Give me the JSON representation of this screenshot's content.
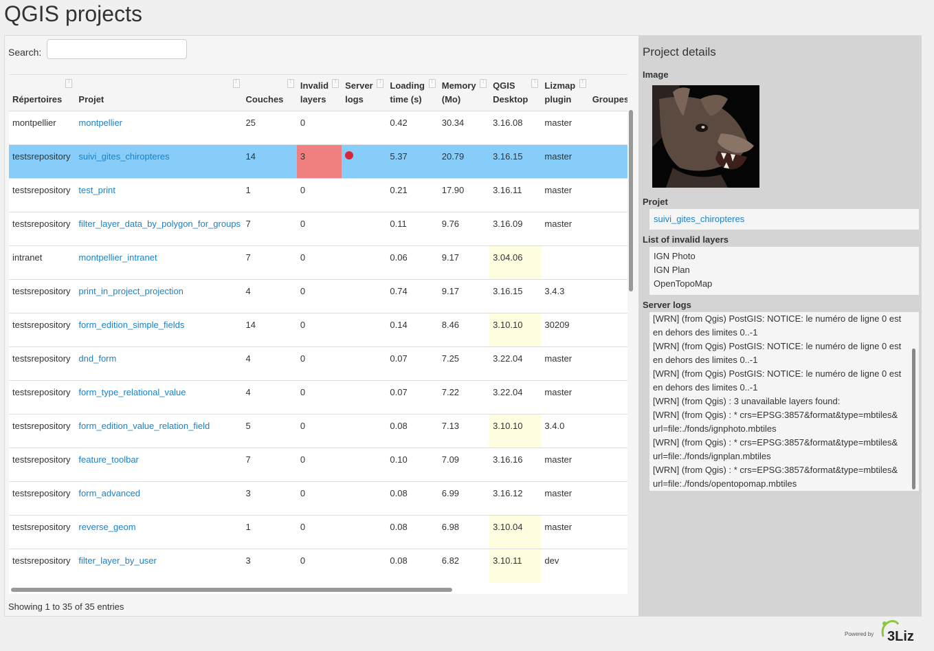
{
  "page": {
    "title": "QGIS projects"
  },
  "search": {
    "label": "Search:",
    "value": ""
  },
  "table": {
    "columns": [
      {
        "line1": "",
        "line2": "Répertoires"
      },
      {
        "line1": "",
        "line2": "Projet"
      },
      {
        "line1": "",
        "line2": "Couches"
      },
      {
        "line1": "Invalid",
        "line2": "layers"
      },
      {
        "line1": "Server",
        "line2": "logs"
      },
      {
        "line1": "Loading",
        "line2": "time (s)"
      },
      {
        "line1": "Memory",
        "line2": "(Mo)"
      },
      {
        "line1": "QGIS",
        "line2": "Desktop"
      },
      {
        "line1": "Lizmap",
        "line2": "plugin"
      },
      {
        "line1": "",
        "line2": "Groupes"
      }
    ],
    "rows": [
      {
        "repo": "montpellier",
        "project": "montpellier",
        "layers": "25",
        "invalid": "0",
        "logs": false,
        "time": "0.42",
        "memory": "30.34",
        "qgis": "3.16.08",
        "qgis_old": false,
        "lizmap": "master",
        "groups": "",
        "selected": false
      },
      {
        "repo": "testsrepository",
        "project": "suivi_gites_chiropteres",
        "layers": "14",
        "invalid": "3",
        "logs": true,
        "time": "5.37",
        "memory": "20.79",
        "qgis": "3.16.15",
        "qgis_old": false,
        "lizmap": "master",
        "groups": "",
        "selected": true
      },
      {
        "repo": "testsrepository",
        "project": "test_print",
        "layers": "1",
        "invalid": "0",
        "logs": false,
        "time": "0.21",
        "memory": "17.90",
        "qgis": "3.16.11",
        "qgis_old": false,
        "lizmap": "master",
        "groups": "",
        "selected": false
      },
      {
        "repo": "testsrepository",
        "project": "filter_layer_data_by_polygon_for_groups",
        "layers": "7",
        "invalid": "0",
        "logs": false,
        "time": "0.11",
        "memory": "9.76",
        "qgis": "3.16.09",
        "qgis_old": false,
        "lizmap": "master",
        "groups": "",
        "selected": false
      },
      {
        "repo": "intranet",
        "project": "montpellier_intranet",
        "layers": "7",
        "invalid": "0",
        "logs": false,
        "time": "0.06",
        "memory": "9.17",
        "qgis": "3.04.06",
        "qgis_old": true,
        "lizmap": "",
        "groups": "",
        "selected": false
      },
      {
        "repo": "testsrepository",
        "project": "print_in_project_projection",
        "layers": "4",
        "invalid": "0",
        "logs": false,
        "time": "0.74",
        "memory": "9.17",
        "qgis": "3.16.15",
        "qgis_old": false,
        "lizmap": "3.4.3",
        "groups": "",
        "selected": false
      },
      {
        "repo": "testsrepository",
        "project": "form_edition_simple_fields",
        "layers": "14",
        "invalid": "0",
        "logs": false,
        "time": "0.14",
        "memory": "8.46",
        "qgis": "3.10.10",
        "qgis_old": true,
        "lizmap": "30209",
        "groups": "",
        "selected": false
      },
      {
        "repo": "testsrepository",
        "project": "dnd_form",
        "layers": "4",
        "invalid": "0",
        "logs": false,
        "time": "0.07",
        "memory": "7.25",
        "qgis": "3.22.04",
        "qgis_old": false,
        "lizmap": "master",
        "groups": "",
        "selected": false
      },
      {
        "repo": "testsrepository",
        "project": "form_type_relational_value",
        "layers": "4",
        "invalid": "0",
        "logs": false,
        "time": "0.07",
        "memory": "7.22",
        "qgis": "3.22.04",
        "qgis_old": false,
        "lizmap": "master",
        "groups": "",
        "selected": false
      },
      {
        "repo": "testsrepository",
        "project": "form_edition_value_relation_field",
        "layers": "5",
        "invalid": "0",
        "logs": false,
        "time": "0.08",
        "memory": "7.13",
        "qgis": "3.10.10",
        "qgis_old": true,
        "lizmap": "3.4.0",
        "groups": "",
        "selected": false
      },
      {
        "repo": "testsrepository",
        "project": "feature_toolbar",
        "layers": "7",
        "invalid": "0",
        "logs": false,
        "time": "0.10",
        "memory": "7.09",
        "qgis": "3.16.16",
        "qgis_old": false,
        "lizmap": "master",
        "groups": "",
        "selected": false
      },
      {
        "repo": "testsrepository",
        "project": "form_advanced",
        "layers": "3",
        "invalid": "0",
        "logs": false,
        "time": "0.08",
        "memory": "6.99",
        "qgis": "3.16.12",
        "qgis_old": false,
        "lizmap": "master",
        "groups": "",
        "selected": false
      },
      {
        "repo": "testsrepository",
        "project": "reverse_geom",
        "layers": "1",
        "invalid": "0",
        "logs": false,
        "time": "0.08",
        "memory": "6.98",
        "qgis": "3.10.04",
        "qgis_old": true,
        "lizmap": "master",
        "groups": "",
        "selected": false
      },
      {
        "repo": "testsrepository",
        "project": "filter_layer_by_user",
        "layers": "3",
        "invalid": "0",
        "logs": false,
        "time": "0.08",
        "memory": "6.82",
        "qgis": "3.10.11",
        "qgis_old": true,
        "lizmap": "dev",
        "groups": "",
        "selected": false
      }
    ],
    "showing": "Showing 1 to 35 of 35 entries"
  },
  "details": {
    "title": "Project details",
    "image_label": "Image",
    "project_label": "Projet",
    "project_name": "suivi_gites_chiropteres",
    "invalid_label": "List of invalid layers",
    "invalid_layers": [
      "IGN Photo",
      "IGN Plan",
      "OpenTopoMap"
    ],
    "logs_label": "Server logs",
    "logs": [
      "[WRN] (from Qgis) PostGIS: NOTICE: le numéro de ligne 0 est",
      "en dehors des limites 0..-1",
      "[WRN] (from Qgis) PostGIS: NOTICE: le numéro de ligne 0 est",
      "en dehors des limites 0..-1",
      "[WRN] (from Qgis) PostGIS: NOTICE: le numéro de ligne 0 est",
      "en dehors des limites 0..-1",
      "[WRN] (from Qgis) : 3 unavailable layers found:",
      "[WRN] (from Qgis) : * crs=EPSG:3857&format&type=mbtiles&",
      "url=file:./fonds/ignphoto.mbtiles",
      "[WRN] (from Qgis) : * crs=EPSG:3857&format&type=mbtiles&",
      "url=file:./fonds/ignplan.mbtiles",
      "[WRN] (from Qgis) : * crs=EPSG:3857&format&type=mbtiles&",
      "url=file:./fonds/opentopomap.mbtiles"
    ]
  },
  "footer": {
    "powered_by": "Powered by",
    "logo_text": "3Liz"
  },
  "colors": {
    "selected_row": "#87cdf9",
    "invalid_cell": "#f08080",
    "old_qgis": "#fffde0",
    "log_dot": "#d9263b",
    "link": "#1a82c9"
  }
}
